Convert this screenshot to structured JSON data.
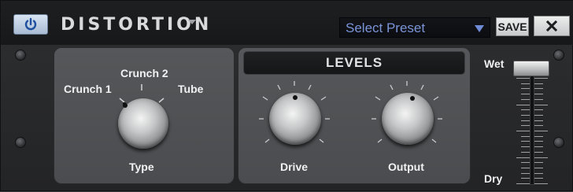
{
  "header": {
    "title": "DISTORTION",
    "preset_select": {
      "value": "Select Preset"
    },
    "save_label": "SAVE",
    "close_label": "✕"
  },
  "type_section": {
    "options": [
      "Crunch 1",
      "Crunch 2",
      "Tube"
    ],
    "knob_label": "Type"
  },
  "levels_section": {
    "title": "LEVELS",
    "drive_label": "Drive",
    "output_label": "Output"
  },
  "mix_slider": {
    "top_label": "Wet",
    "bottom_label": "Dry",
    "value": 1.0
  },
  "colors": {
    "accent_blue": "#7a94d8",
    "panel_gray": "#4f5154",
    "header_dark": "#1a1b1d"
  },
  "icons": {
    "power": "power-icon",
    "dropdown": "dropdown-arrow-icon",
    "close": "close-icon"
  }
}
